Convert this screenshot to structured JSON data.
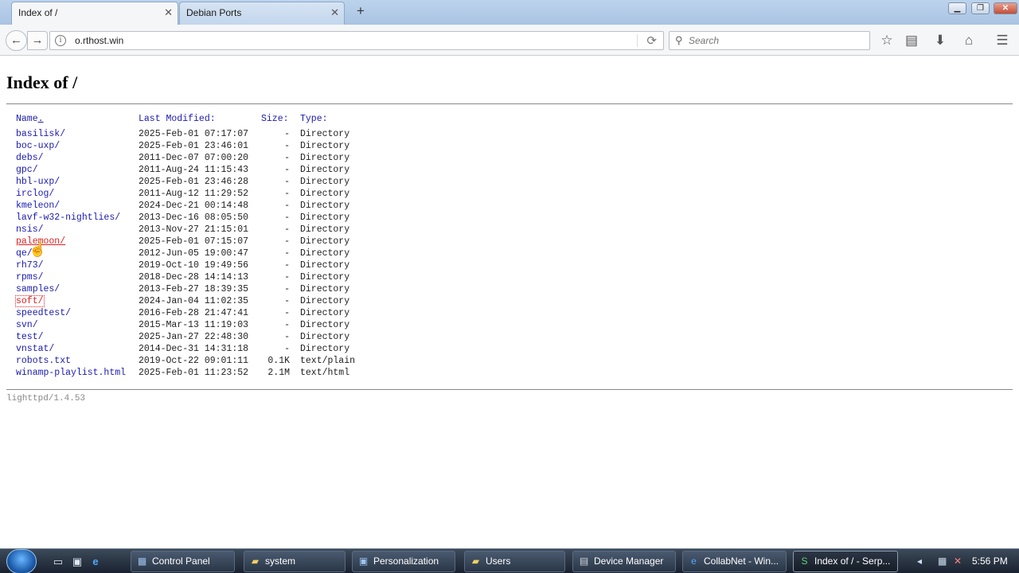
{
  "browser": {
    "tabs": [
      {
        "label": "Index of /",
        "active": true
      },
      {
        "label": "Debian Ports",
        "active": false
      }
    ],
    "new_tab_label": "+",
    "url": "o.rthost.win",
    "search_placeholder": "Search",
    "icons": [
      "back-icon",
      "forward-icon",
      "info-icon",
      "reload-icon",
      "search-icon",
      "bookmark-star-icon",
      "reading-list-icon",
      "download-icon",
      "home-icon",
      "menu-icon"
    ]
  },
  "page": {
    "title": "Index of /",
    "headers": {
      "name": "Name",
      "modified": "Last Modified:",
      "size": "Size:",
      "type": "Type:"
    },
    "entries": [
      {
        "name": "basilisk/",
        "modified": "2025-Feb-01 07:17:07",
        "size": "-",
        "type": "Directory"
      },
      {
        "name": "boc-uxp/",
        "modified": "2025-Feb-01 23:46:01",
        "size": "-",
        "type": "Directory"
      },
      {
        "name": "debs/",
        "modified": "2011-Dec-07 07:00:20",
        "size": "-",
        "type": "Directory"
      },
      {
        "name": "gpc/",
        "modified": "2011-Aug-24 11:15:43",
        "size": "-",
        "type": "Directory"
      },
      {
        "name": "hbl-uxp/",
        "modified": "2025-Feb-01 23:46:28",
        "size": "-",
        "type": "Directory"
      },
      {
        "name": "irclog/",
        "modified": "2011-Aug-12 11:29:52",
        "size": "-",
        "type": "Directory"
      },
      {
        "name": "kmeleon/",
        "modified": "2024-Dec-21 00:14:48",
        "size": "-",
        "type": "Directory"
      },
      {
        "name": "lavf-w32-nightlies/",
        "modified": "2013-Dec-16 08:05:50",
        "size": "-",
        "type": "Directory"
      },
      {
        "name": "nsis/",
        "modified": "2013-Nov-27 21:15:01",
        "size": "-",
        "type": "Directory"
      },
      {
        "name": "palemoon/",
        "modified": "2025-Feb-01 07:15:07",
        "size": "-",
        "type": "Directory"
      },
      {
        "name": "qe/",
        "modified": "2012-Jun-05 19:00:47",
        "size": "-",
        "type": "Directory"
      },
      {
        "name": "rh73/",
        "modified": "2019-Oct-10 19:49:56",
        "size": "-",
        "type": "Directory"
      },
      {
        "name": "rpms/",
        "modified": "2018-Dec-28 14:14:13",
        "size": "-",
        "type": "Directory"
      },
      {
        "name": "samples/",
        "modified": "2013-Feb-27 18:39:35",
        "size": "-",
        "type": "Directory"
      },
      {
        "name": "soft/",
        "modified": "2024-Jan-04 11:02:35",
        "size": "-",
        "type": "Directory"
      },
      {
        "name": "speedtest/",
        "modified": "2016-Feb-28 21:47:41",
        "size": "-",
        "type": "Directory"
      },
      {
        "name": "svn/",
        "modified": "2015-Mar-13 11:19:03",
        "size": "-",
        "type": "Directory"
      },
      {
        "name": "test/",
        "modified": "2025-Jan-27 22:48:30",
        "size": "-",
        "type": "Directory"
      },
      {
        "name": "vnstat/",
        "modified": "2014-Dec-31 14:31:18",
        "size": "-",
        "type": "Directory"
      },
      {
        "name": "robots.txt",
        "modified": "2019-Oct-22 09:01:11",
        "size": "0.1K",
        "type": "text/plain"
      },
      {
        "name": "winamp-playlist.html",
        "modified": "2025-Feb-01 11:23:52",
        "size": "2.1M",
        "type": "text/html"
      }
    ],
    "footer": "lighttpd/1.4.53"
  },
  "taskbar": {
    "tasks": [
      {
        "label": "Control Panel",
        "icon": "control-panel-icon",
        "active": false
      },
      {
        "label": "system",
        "icon": "folder-icon",
        "active": false
      },
      {
        "label": "Personalization",
        "icon": "personalization-icon",
        "active": false
      },
      {
        "label": "Users",
        "icon": "folder-icon",
        "active": false
      },
      {
        "label": "Device Manager",
        "icon": "device-manager-icon",
        "active": false
      },
      {
        "label": "CollabNet - Win...",
        "icon": "ie-icon",
        "active": false
      },
      {
        "label": "Index of / - Serp...",
        "icon": "serpent-browser-icon",
        "active": true
      }
    ],
    "clock": "5:56 PM"
  }
}
